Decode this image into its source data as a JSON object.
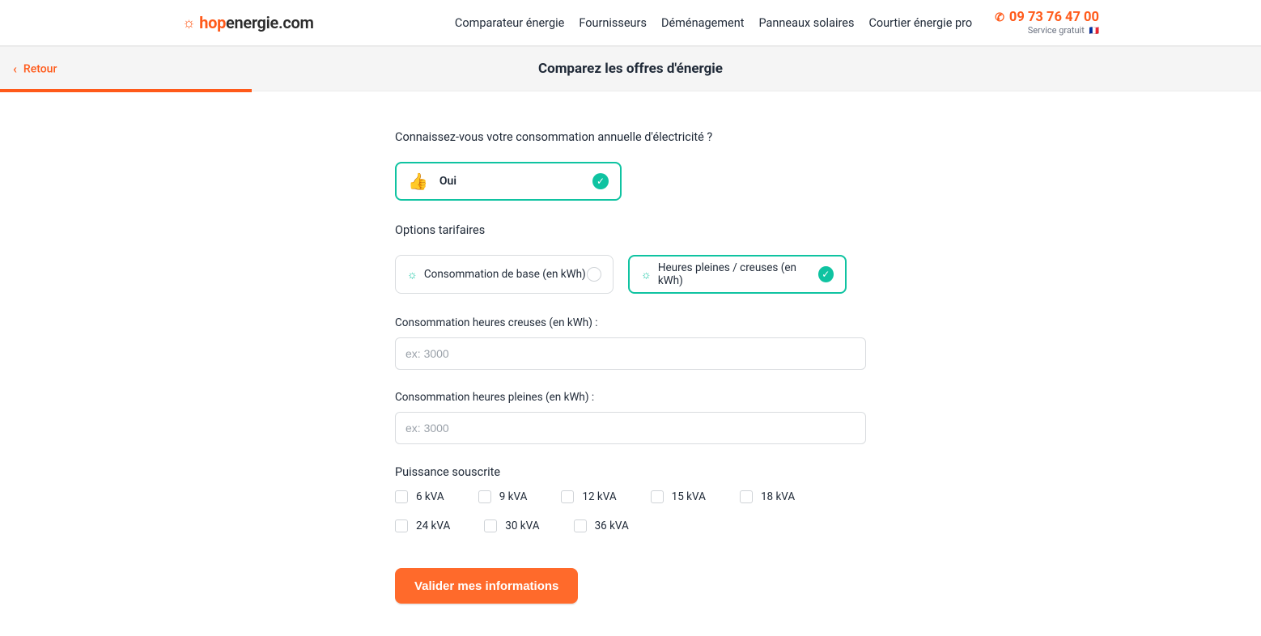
{
  "header": {
    "logo": {
      "hop": "hop",
      "energie": "energie.com"
    },
    "nav": [
      "Comparateur énergie",
      "Fournisseurs",
      "Déménagement",
      "Panneaux solaires",
      "Courtier énergie pro"
    ],
    "phone": "09 73 76 47 00",
    "phone_sub": "Service gratuit",
    "flag": "🇫🇷"
  },
  "subheader": {
    "back": "Retour",
    "title": "Comparez les offres d'énergie"
  },
  "form": {
    "q1": "Connaissez-vous votre consommation annuelle d'électricité ?",
    "q1_answer": "Oui",
    "options_label": "Options tarifaires",
    "opt_base": "Consommation de base (en kWh)",
    "opt_hphc": "Heures pleines / creuses (en kWh)",
    "hc_label": "Consommation heures creuses (en kWh) :",
    "hp_label": "Consommation heures pleines (en kWh) :",
    "placeholder": "ex: 3000",
    "power_label": "Puissance souscrite",
    "powers": [
      "6 kVA",
      "9 kVA",
      "12 kVA",
      "15 kVA",
      "18 kVA",
      "24 kVA",
      "30 kVA",
      "36 kVA"
    ],
    "submit": "Valider mes informations"
  }
}
